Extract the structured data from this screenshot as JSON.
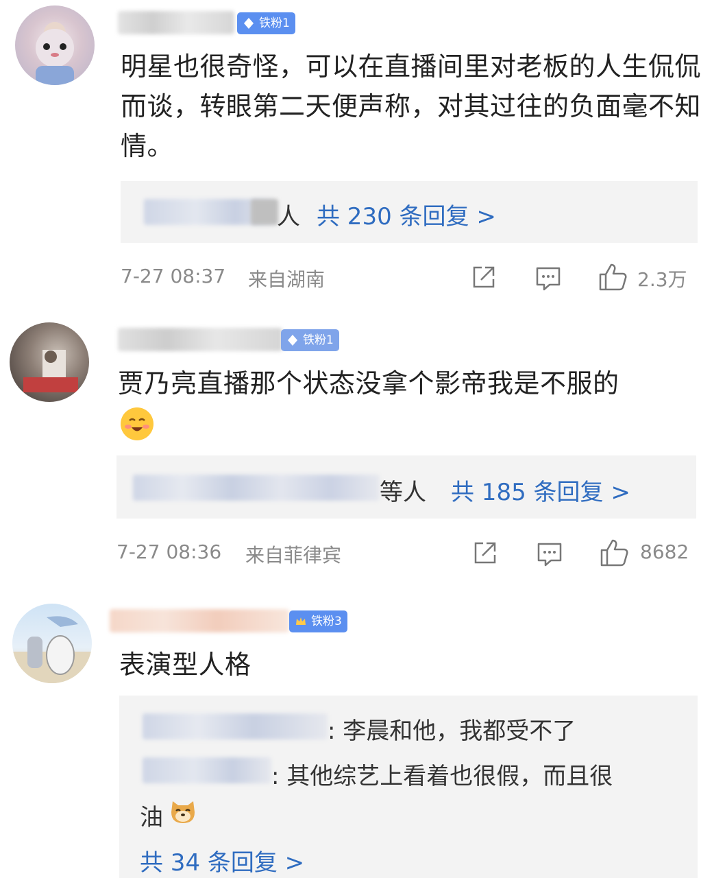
{
  "comments": [
    {
      "badge": "铁粉1",
      "text": "明星也很奇怪，可以在直播间里对老板的人生侃侃而谈，转眼第二天便声称，对其过往的负面毫不知情。",
      "reply_summary_tail": "人",
      "reply_link": "共 230 条回复 >",
      "time": "7-27 08:37",
      "location": "来自湖南",
      "likes": "2.3万"
    },
    {
      "badge": "铁粉1",
      "text": "贾乃亮直播那个状态没拿个影帝我是不服的",
      "reply_summary_tail": "等人",
      "reply_link": "共 185 条回复 >",
      "time": "7-27 08:36",
      "location": "来自菲律宾",
      "likes": "8682"
    },
    {
      "badge": "铁粉3",
      "text": "表演型人格",
      "replies": [
        {
          "text": ": 李晨和他，我都受不了"
        },
        {
          "text": ": 其他综艺上看着也很假，而且很",
          "text2": "油"
        }
      ],
      "reply_link": "共 34 条回复 >"
    }
  ],
  "icons": {
    "repost": "share-icon",
    "comment": "comment-icon",
    "like": "thumbs-up-icon",
    "badge": "diamond-icon"
  },
  "colors": {
    "badge": "#5b8ff0",
    "link": "#2f6cc0",
    "meta": "#8a8a8a",
    "reply_bg": "#f3f3f3"
  }
}
